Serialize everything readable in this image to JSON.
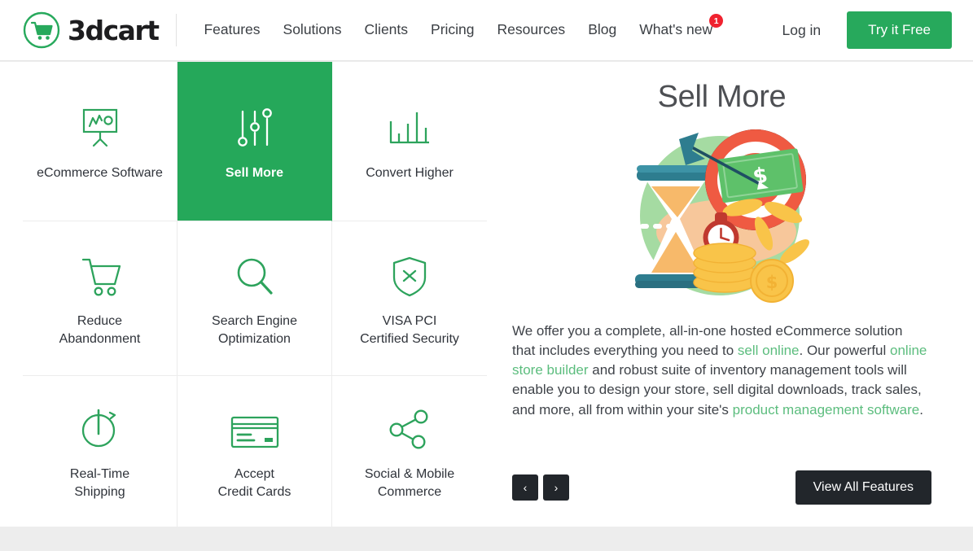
{
  "header": {
    "logo_word": "3dcart",
    "logo_icon": "shopping-cart-circle-logo",
    "nav_items": [
      {
        "label": "Features",
        "badge": null
      },
      {
        "label": "Solutions",
        "badge": null
      },
      {
        "label": "Clients",
        "badge": null
      },
      {
        "label": "Pricing",
        "badge": null
      },
      {
        "label": "Resources",
        "badge": null
      },
      {
        "label": "Blog",
        "badge": null
      },
      {
        "label": "What's new",
        "badge": "1"
      }
    ],
    "login_label": "Log in",
    "cta_label": "Try it Free"
  },
  "tiles": [
    {
      "label": "eCommerce Software",
      "icon": "presentation-chart-icon",
      "active": false
    },
    {
      "label": "Sell More",
      "icon": "sliders-icon",
      "active": true
    },
    {
      "label": "Convert Higher",
      "icon": "bar-chart-icon",
      "active": false
    },
    {
      "label": "Reduce\nAbandonment",
      "icon": "shopping-cart-icon",
      "active": false
    },
    {
      "label": "Search Engine\nOptimization",
      "icon": "magnifier-icon",
      "active": false
    },
    {
      "label": "VISA PCI\nCertified Security",
      "icon": "shield-x-icon",
      "active": false
    },
    {
      "label": "Real-Time\nShipping",
      "icon": "stopwatch-icon",
      "active": false
    },
    {
      "label": "Accept\nCredit Cards",
      "icon": "credit-card-icon",
      "active": false
    },
    {
      "label": "Social & Mobile\nCommerce",
      "icon": "share-nodes-icon",
      "active": false
    }
  ],
  "detail": {
    "title": "Sell More",
    "illustration": "hourglass-target-money-illustration",
    "body": {
      "part1": "We offer you a complete, all-in-one hosted eCommerce solution that includes everything you need to ",
      "link1": "sell online",
      "part2": ". Our powerful ",
      "link2": "online store builder",
      "part3": " and robust suite of inventory management tools will enable you to design your store, sell digital downloads, track sales, and more, all from within your site's ",
      "link3": "product management software",
      "part4": "."
    },
    "prev_label": "‹",
    "next_label": "›",
    "view_all_label": "View All Features"
  },
  "colors": {
    "brand_green": "#27a95c",
    "tile_active_green": "#25a85a",
    "link_green": "#5cbd7e",
    "dark_button": "#22262b",
    "badge_red": "#f0222f",
    "page_background": "#ededed"
  }
}
